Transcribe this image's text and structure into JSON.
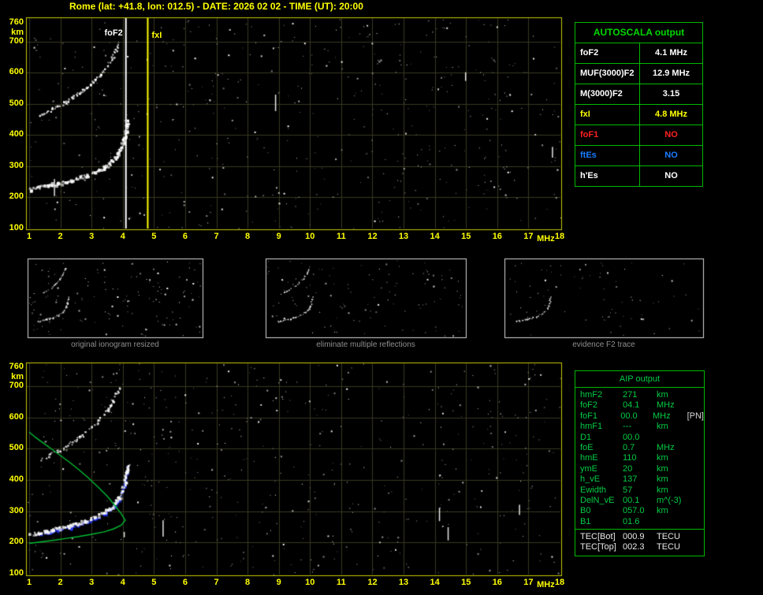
{
  "title": "Rome (lat: +41.8, lon: 012.5) - DATE: 2026 02 02 - TIME (UT): 20:00",
  "autoscala_table": {
    "header": "AUTOSCALA output",
    "rows": [
      {
        "label": "foF2",
        "value": "4.1 MHz",
        "color": "#ffffff"
      },
      {
        "label": "MUF(3000)F2",
        "value": "12.9 MHz",
        "color": "#ffffff"
      },
      {
        "label": "M(3000)F2",
        "value": "3.15",
        "color": "#ffffff"
      },
      {
        "label": "fxI",
        "value": "4.8 MHz",
        "color": "#ffff00"
      },
      {
        "label": "foF1",
        "value": "NO",
        "color": "#ff2020"
      },
      {
        "label": "ftEs",
        "value": "NO",
        "color": "#1a7cff"
      },
      {
        "label": "h'Es",
        "value": "NO",
        "color": "#ffffff"
      }
    ]
  },
  "thumbnails": [
    {
      "caption": "original ionogram resized"
    },
    {
      "caption": "eliminate multiple reflections"
    },
    {
      "caption": "evidence F2 trace"
    }
  ],
  "aip_table": {
    "header": "AIP output",
    "rows": [
      {
        "label": "hmF2",
        "value": "271",
        "unit": "km",
        "extra": ""
      },
      {
        "label": "foF2",
        "value": "04.1",
        "unit": "MHz",
        "extra": ""
      },
      {
        "label": "foF1",
        "value": "00.0",
        "unit": "MHz",
        "extra": "[PN]"
      },
      {
        "label": "hmF1",
        "value": "---",
        "unit": "km",
        "extra": ""
      },
      {
        "label": "D1",
        "value": "00.0",
        "unit": "",
        "extra": ""
      },
      {
        "label": "foE",
        "value": "0.7",
        "unit": "MHz",
        "extra": ""
      },
      {
        "label": "hmE",
        "value": "110",
        "unit": "km",
        "extra": ""
      },
      {
        "label": "ymE",
        "value": "20",
        "unit": "km",
        "extra": ""
      },
      {
        "label": "h_vE",
        "value": "137",
        "unit": "km",
        "extra": ""
      },
      {
        "label": "Ewidth",
        "value": "57",
        "unit": "km",
        "extra": ""
      },
      {
        "label": "DelN_vE",
        "value": "00.1",
        "unit": "m^(-3)",
        "extra": ""
      },
      {
        "label": "B0",
        "value": "057.0",
        "unit": "km",
        "extra": ""
      },
      {
        "label": "B1",
        "value": "01.6",
        "unit": "",
        "extra": ""
      }
    ],
    "tec_rows": [
      {
        "label": "TEC[Bot]",
        "value": "000.9",
        "unit": "TECU",
        "extra": ""
      },
      {
        "label": "TEC[Top]",
        "value": "002.3",
        "unit": "TECU",
        "extra": ""
      }
    ]
  },
  "colors": {
    "background": "#000000",
    "axis_text": "#ffff00",
    "plot_border": "#c8c800",
    "grid": "#383822",
    "table_border": "#00b800",
    "autoscala_header": "#00d800",
    "aip_text": "#00cc44",
    "tec_text": "#e8e8e8",
    "caption_text": "#8f8f8f",
    "trace": "#ffffff",
    "profile": "#00bb33",
    "restored_trace": "#2233ee",
    "foF2_line": "#ffffff",
    "fxI_line": "#ffff00"
  },
  "chart_data": [
    {
      "type": "scatter",
      "title": "ionogram with AUTOSCALA scaling",
      "xlabel": "MHz",
      "ylabel": "km",
      "xlim": [
        1,
        18
      ],
      "ylim": [
        100,
        760
      ],
      "x_ticks": [
        "1",
        "2",
        "3",
        "4",
        "5",
        "6",
        "7",
        "8",
        "9",
        "10",
        "11",
        "12",
        "13",
        "14",
        "15",
        "16",
        "17",
        "18"
      ],
      "y_ticks": [
        760,
        700,
        600,
        500,
        400,
        300,
        200,
        100
      ],
      "grid": true,
      "annotations": [
        {
          "name": "foF2",
          "freq": 4.1,
          "color": "#ffffff"
        },
        {
          "name": "fxI",
          "freq": 4.8,
          "color": "#ffff00"
        }
      ],
      "series": [
        {
          "name": "F2-trace",
          "color": "#ffffff",
          "points": [
            [
              1.0,
              228
            ],
            [
              1.3,
              234
            ],
            [
              1.6,
              240
            ],
            [
              1.9,
              247
            ],
            [
              2.2,
              254
            ],
            [
              2.5,
              262
            ],
            [
              2.8,
              272
            ],
            [
              3.1,
              283
            ],
            [
              3.35,
              296
            ],
            [
              3.55,
              310
            ],
            [
              3.72,
              326
            ],
            [
              3.85,
              344
            ],
            [
              3.95,
              365
            ],
            [
              4.03,
              389
            ],
            [
              4.08,
              411
            ],
            [
              4.12,
              431
            ],
            [
              4.15,
              449
            ]
          ]
        },
        {
          "name": "second-reflection",
          "color": "#ffffff",
          "points": [
            [
              1.35,
              468
            ],
            [
              1.6,
              480
            ],
            [
              1.85,
              492
            ],
            [
              2.1,
              505
            ],
            [
              2.35,
              520
            ],
            [
              2.6,
              537
            ],
            [
              2.85,
              556
            ],
            [
              3.1,
              578
            ],
            [
              3.3,
              600
            ],
            [
              3.5,
              625
            ],
            [
              3.65,
              650
            ],
            [
              3.78,
              675
            ],
            [
              3.88,
              700
            ]
          ]
        }
      ]
    },
    {
      "type": "scatter",
      "title": "ionogram with restored trace and electron density profile (AIP)",
      "xlabel": "MHz",
      "ylabel": "km",
      "xlim": [
        1,
        18
      ],
      "ylim": [
        100,
        760
      ],
      "x_ticks": [
        "1",
        "2",
        "3",
        "4",
        "5",
        "6",
        "7",
        "8",
        "9",
        "10",
        "11",
        "12",
        "13",
        "14",
        "15",
        "16",
        "17",
        "18"
      ],
      "y_ticks": [
        760,
        700,
        600,
        500,
        400,
        300,
        200,
        100
      ],
      "grid": true,
      "annotations": [],
      "series": [
        {
          "name": "F2-trace",
          "color": "#ffffff",
          "points": [
            [
              1.0,
              228
            ],
            [
              1.3,
              234
            ],
            [
              1.6,
              240
            ],
            [
              1.9,
              247
            ],
            [
              2.2,
              254
            ],
            [
              2.5,
              262
            ],
            [
              2.8,
              272
            ],
            [
              3.1,
              283
            ],
            [
              3.35,
              296
            ],
            [
              3.55,
              310
            ],
            [
              3.72,
              326
            ],
            [
              3.85,
              344
            ],
            [
              3.95,
              365
            ],
            [
              4.03,
              389
            ],
            [
              4.08,
              411
            ],
            [
              4.12,
              431
            ],
            [
              4.15,
              449
            ]
          ]
        },
        {
          "name": "second-reflection",
          "color": "#ffffff",
          "points": [
            [
              1.35,
              468
            ],
            [
              1.6,
              480
            ],
            [
              1.85,
              492
            ],
            [
              2.1,
              505
            ],
            [
              2.35,
              520
            ],
            [
              2.6,
              537
            ],
            [
              2.85,
              556
            ],
            [
              3.1,
              578
            ],
            [
              3.3,
              600
            ],
            [
              3.5,
              625
            ],
            [
              3.65,
              650
            ],
            [
              3.78,
              675
            ],
            [
              3.88,
              700
            ]
          ]
        },
        {
          "name": "restored-trace",
          "color": "#2233ee",
          "points": [
            [
              1.3,
              234
            ],
            [
              1.6,
              240
            ],
            [
              1.9,
              247
            ],
            [
              2.2,
              254
            ],
            [
              2.5,
              262
            ],
            [
              2.8,
              272
            ],
            [
              3.1,
              283
            ],
            [
              3.35,
              296
            ],
            [
              3.55,
              310
            ],
            [
              3.72,
              326
            ],
            [
              3.85,
              344
            ],
            [
              3.95,
              365
            ],
            [
              4.03,
              389
            ],
            [
              4.08,
              411
            ],
            [
              4.12,
              431
            ],
            [
              4.15,
              449
            ]
          ]
        },
        {
          "name": "electron-density-profile",
          "color": "#00bb33",
          "points": [
            [
              1.0,
              553
            ],
            [
              1.2,
              536
            ],
            [
              1.45,
              518
            ],
            [
              1.7,
              500
            ],
            [
              2.0,
              478
            ],
            [
              2.3,
              456
            ],
            [
              2.6,
              432
            ],
            [
              2.9,
              406
            ],
            [
              3.2,
              378
            ],
            [
              3.5,
              348
            ],
            [
              3.75,
              318
            ],
            [
              3.95,
              292
            ],
            [
              4.08,
              271
            ],
            [
              3.95,
              255
            ],
            [
              3.7,
              243
            ],
            [
              3.4,
              234
            ],
            [
              3.0,
              226
            ],
            [
              2.6,
              219
            ],
            [
              2.2,
              213
            ],
            [
              1.8,
              207
            ],
            [
              1.4,
              202
            ],
            [
              1.0,
              197
            ]
          ]
        }
      ]
    }
  ]
}
